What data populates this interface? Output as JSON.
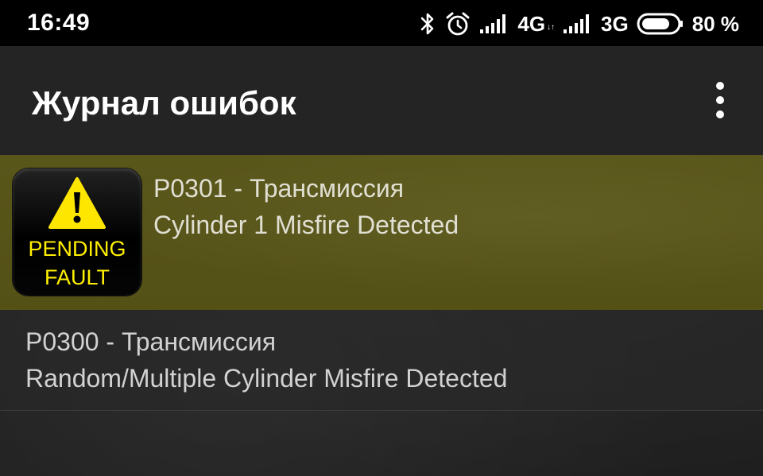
{
  "status_bar": {
    "time": "16:49",
    "icons": [
      "bluetooth-icon",
      "alarm-icon",
      "signal-icon",
      "signal-icon",
      "battery-icon"
    ],
    "network_1": "4G",
    "network_1_sub": "↓↑",
    "network_2": "3G",
    "battery_level": 0.8,
    "battery_percent": "80 %"
  },
  "app_bar": {
    "title": "Журнал ошибок",
    "menu_icon": "more-vert-icon"
  },
  "colors": {
    "selected_row": "#57541a",
    "fault_text": "#ffef00",
    "warning_triangle": "#ffe600"
  },
  "faults": [
    {
      "code_line": "P0301 - Трансмиссия",
      "description": "Cylinder 1 Misfire Detected",
      "selected": true,
      "badge": {
        "line1": "PENDING",
        "line2": "FAULT",
        "icon": "warning-icon"
      }
    },
    {
      "code_line": "P0300 - Трансмиссия",
      "description": "Random/Multiple Cylinder Misfire Detected",
      "selected": false
    }
  ]
}
